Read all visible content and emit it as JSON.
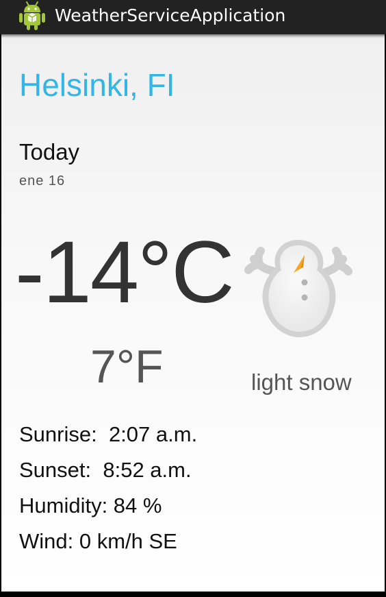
{
  "app": {
    "title": "WeatherServiceApplication",
    "icon": "android-robot-icon"
  },
  "location": {
    "city": "Helsinki, FI"
  },
  "forecast": {
    "day_label": "Today",
    "date_label": "ene  16",
    "temperature_c": "-14°C",
    "temperature_f": "7°F",
    "condition": "light snow",
    "condition_icon": "snowman-icon"
  },
  "details": {
    "sunrise": "Sunrise:  2:07 a.m.",
    "sunset": "Sunset:  8:52 a.m.",
    "humidity": "Humidity: 84 %",
    "wind": "Wind: 0 km/h SE"
  },
  "colors": {
    "accent": "#33b5e5",
    "actionbar": "#222222",
    "snowman_nose": "#f5a623"
  }
}
